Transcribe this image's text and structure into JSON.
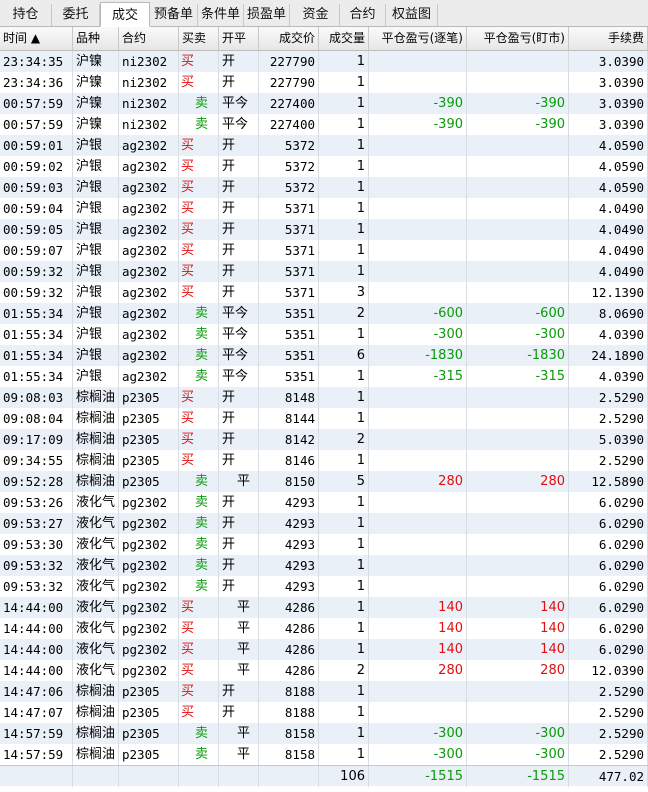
{
  "tabs": [
    "持仓",
    "委托",
    "成交",
    "预备单",
    "条件单",
    "损盈单",
    "资金",
    "合约",
    "权益图"
  ],
  "active_tab": "成交",
  "columns": [
    "时间 ▲",
    "品种",
    "合约",
    "买卖",
    "开平",
    "成交价",
    "成交量",
    "平仓盈亏(逐笔)",
    "平仓盈亏(盯市)",
    "手续费"
  ],
  "rows": [
    {
      "time": "23:34:35",
      "product": "沪镍",
      "contract": "ni2302",
      "side": "买",
      "offset": "开",
      "price": "227790",
      "qty": "1",
      "pnl_trade": "",
      "pnl_mtm": "",
      "fee": "3.0390"
    },
    {
      "time": "23:34:36",
      "product": "沪镍",
      "contract": "ni2302",
      "side": "买",
      "offset": "开",
      "price": "227790",
      "qty": "1",
      "pnl_trade": "",
      "pnl_mtm": "",
      "fee": "3.0390"
    },
    {
      "time": "00:57:59",
      "product": "沪镍",
      "contract": "ni2302",
      "side": "卖",
      "offset": "平今",
      "price": "227400",
      "qty": "1",
      "pnl_trade": "-390",
      "pnl_mtm": "-390",
      "fee": "3.0390"
    },
    {
      "time": "00:57:59",
      "product": "沪镍",
      "contract": "ni2302",
      "side": "卖",
      "offset": "平今",
      "price": "227400",
      "qty": "1",
      "pnl_trade": "-390",
      "pnl_mtm": "-390",
      "fee": "3.0390"
    },
    {
      "time": "00:59:01",
      "product": "沪银",
      "contract": "ag2302",
      "side": "买",
      "offset": "开",
      "price": "5372",
      "qty": "1",
      "pnl_trade": "",
      "pnl_mtm": "",
      "fee": "4.0590"
    },
    {
      "time": "00:59:02",
      "product": "沪银",
      "contract": "ag2302",
      "side": "买",
      "offset": "开",
      "price": "5372",
      "qty": "1",
      "pnl_trade": "",
      "pnl_mtm": "",
      "fee": "4.0590"
    },
    {
      "time": "00:59:03",
      "product": "沪银",
      "contract": "ag2302",
      "side": "买",
      "offset": "开",
      "price": "5372",
      "qty": "1",
      "pnl_trade": "",
      "pnl_mtm": "",
      "fee": "4.0590"
    },
    {
      "time": "00:59:04",
      "product": "沪银",
      "contract": "ag2302",
      "side": "买",
      "offset": "开",
      "price": "5371",
      "qty": "1",
      "pnl_trade": "",
      "pnl_mtm": "",
      "fee": "4.0490"
    },
    {
      "time": "00:59:05",
      "product": "沪银",
      "contract": "ag2302",
      "side": "买",
      "offset": "开",
      "price": "5371",
      "qty": "1",
      "pnl_trade": "",
      "pnl_mtm": "",
      "fee": "4.0490"
    },
    {
      "time": "00:59:07",
      "product": "沪银",
      "contract": "ag2302",
      "side": "买",
      "offset": "开",
      "price": "5371",
      "qty": "1",
      "pnl_trade": "",
      "pnl_mtm": "",
      "fee": "4.0490"
    },
    {
      "time": "00:59:32",
      "product": "沪银",
      "contract": "ag2302",
      "side": "买",
      "offset": "开",
      "price": "5371",
      "qty": "1",
      "pnl_trade": "",
      "pnl_mtm": "",
      "fee": "4.0490"
    },
    {
      "time": "00:59:32",
      "product": "沪银",
      "contract": "ag2302",
      "side": "买",
      "offset": "开",
      "price": "5371",
      "qty": "3",
      "pnl_trade": "",
      "pnl_mtm": "",
      "fee": "12.1390"
    },
    {
      "time": "01:55:34",
      "product": "沪银",
      "contract": "ag2302",
      "side": "卖",
      "offset": "平今",
      "price": "5351",
      "qty": "2",
      "pnl_trade": "-600",
      "pnl_mtm": "-600",
      "fee": "8.0690"
    },
    {
      "time": "01:55:34",
      "product": "沪银",
      "contract": "ag2302",
      "side": "卖",
      "offset": "平今",
      "price": "5351",
      "qty": "1",
      "pnl_trade": "-300",
      "pnl_mtm": "-300",
      "fee": "4.0390"
    },
    {
      "time": "01:55:34",
      "product": "沪银",
      "contract": "ag2302",
      "side": "卖",
      "offset": "平今",
      "price": "5351",
      "qty": "6",
      "pnl_trade": "-1830",
      "pnl_mtm": "-1830",
      "fee": "24.1890"
    },
    {
      "time": "01:55:34",
      "product": "沪银",
      "contract": "ag2302",
      "side": "卖",
      "offset": "平今",
      "price": "5351",
      "qty": "1",
      "pnl_trade": "-315",
      "pnl_mtm": "-315",
      "fee": "4.0390"
    },
    {
      "time": "09:08:03",
      "product": "棕榈油",
      "contract": "p2305",
      "side": "买",
      "offset": "开",
      "price": "8148",
      "qty": "1",
      "pnl_trade": "",
      "pnl_mtm": "",
      "fee": "2.5290"
    },
    {
      "time": "09:08:04",
      "product": "棕榈油",
      "contract": "p2305",
      "side": "买",
      "offset": "开",
      "price": "8144",
      "qty": "1",
      "pnl_trade": "",
      "pnl_mtm": "",
      "fee": "2.5290"
    },
    {
      "time": "09:17:09",
      "product": "棕榈油",
      "contract": "p2305",
      "side": "买",
      "offset": "开",
      "price": "8142",
      "qty": "2",
      "pnl_trade": "",
      "pnl_mtm": "",
      "fee": "5.0390"
    },
    {
      "time": "09:34:55",
      "product": "棕榈油",
      "contract": "p2305",
      "side": "买",
      "offset": "开",
      "price": "8146",
      "qty": "1",
      "pnl_trade": "",
      "pnl_mtm": "",
      "fee": "2.5290"
    },
    {
      "time": "09:52:28",
      "product": "棕榈油",
      "contract": "p2305",
      "side": "卖",
      "offset": "平",
      "price": "8150",
      "qty": "5",
      "pnl_trade": "280",
      "pnl_mtm": "280",
      "fee": "12.5890"
    },
    {
      "time": "09:53:26",
      "product": "液化气",
      "contract": "pg2302",
      "side": "卖",
      "offset": "开",
      "price": "4293",
      "qty": "1",
      "pnl_trade": "",
      "pnl_mtm": "",
      "fee": "6.0290"
    },
    {
      "time": "09:53:27",
      "product": "液化气",
      "contract": "pg2302",
      "side": "卖",
      "offset": "开",
      "price": "4293",
      "qty": "1",
      "pnl_trade": "",
      "pnl_mtm": "",
      "fee": "6.0290"
    },
    {
      "time": "09:53:30",
      "product": "液化气",
      "contract": "pg2302",
      "side": "卖",
      "offset": "开",
      "price": "4293",
      "qty": "1",
      "pnl_trade": "",
      "pnl_mtm": "",
      "fee": "6.0290"
    },
    {
      "time": "09:53:32",
      "product": "液化气",
      "contract": "pg2302",
      "side": "卖",
      "offset": "开",
      "price": "4293",
      "qty": "1",
      "pnl_trade": "",
      "pnl_mtm": "",
      "fee": "6.0290"
    },
    {
      "time": "09:53:32",
      "product": "液化气",
      "contract": "pg2302",
      "side": "卖",
      "offset": "开",
      "price": "4293",
      "qty": "1",
      "pnl_trade": "",
      "pnl_mtm": "",
      "fee": "6.0290"
    },
    {
      "time": "14:44:00",
      "product": "液化气",
      "contract": "pg2302",
      "side": "买",
      "offset": "平",
      "price": "4286",
      "qty": "1",
      "pnl_trade": "140",
      "pnl_mtm": "140",
      "fee": "6.0290"
    },
    {
      "time": "14:44:00",
      "product": "液化气",
      "contract": "pg2302",
      "side": "买",
      "offset": "平",
      "price": "4286",
      "qty": "1",
      "pnl_trade": "140",
      "pnl_mtm": "140",
      "fee": "6.0290"
    },
    {
      "time": "14:44:00",
      "product": "液化气",
      "contract": "pg2302",
      "side": "买",
      "offset": "平",
      "price": "4286",
      "qty": "1",
      "pnl_trade": "140",
      "pnl_mtm": "140",
      "fee": "6.0290"
    },
    {
      "time": "14:44:00",
      "product": "液化气",
      "contract": "pg2302",
      "side": "买",
      "offset": "平",
      "price": "4286",
      "qty": "2",
      "pnl_trade": "280",
      "pnl_mtm": "280",
      "fee": "12.0390"
    },
    {
      "time": "14:47:06",
      "product": "棕榈油",
      "contract": "p2305",
      "side": "买",
      "offset": "开",
      "price": "8188",
      "qty": "1",
      "pnl_trade": "",
      "pnl_mtm": "",
      "fee": "2.5290"
    },
    {
      "time": "14:47:07",
      "product": "棕榈油",
      "contract": "p2305",
      "side": "买",
      "offset": "开",
      "price": "8188",
      "qty": "1",
      "pnl_trade": "",
      "pnl_mtm": "",
      "fee": "2.5290"
    },
    {
      "time": "14:57:59",
      "product": "棕榈油",
      "contract": "p2305",
      "side": "卖",
      "offset": "平",
      "price": "8158",
      "qty": "1",
      "pnl_trade": "-300",
      "pnl_mtm": "-300",
      "fee": "2.5290"
    },
    {
      "time": "14:57:59",
      "product": "棕榈油",
      "contract": "p2305",
      "side": "卖",
      "offset": "平",
      "price": "8158",
      "qty": "1",
      "pnl_trade": "-300",
      "pnl_mtm": "-300",
      "fee": "2.5290"
    }
  ],
  "totals": {
    "qty": "106",
    "pnl_trade": "-1515",
    "pnl_mtm": "-1515",
    "fee": "477.02"
  },
  "colors": {
    "buy": "#e01010",
    "sell": "#0a9a0a",
    "loss": "#0a9a0a",
    "profit": "#e01010"
  }
}
